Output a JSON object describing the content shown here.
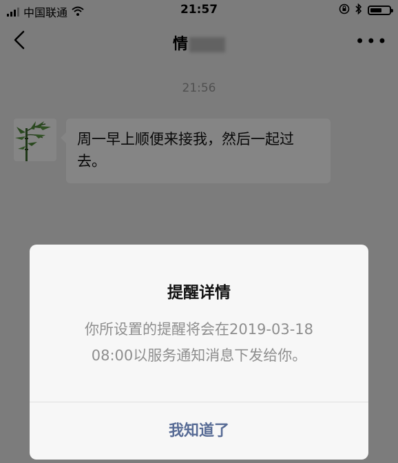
{
  "status_bar": {
    "carrier": "中国联通",
    "time": "21:57",
    "battery_level": 0.68
  },
  "nav": {
    "title": "情",
    "more_label": "•••"
  },
  "chat": {
    "timestamp": "21:56",
    "message": "周一早上顺便来接我，然后一起过去。"
  },
  "dialog": {
    "title": "提醒详情",
    "body_line1": "你所设置的提醒将会在2019-03-18",
    "body_line2": "08:00以服务通知消息下发给你。",
    "button": "我知道了"
  },
  "colors": {
    "link_blue": "#576b95",
    "body_gray": "#8e8e8e"
  }
}
